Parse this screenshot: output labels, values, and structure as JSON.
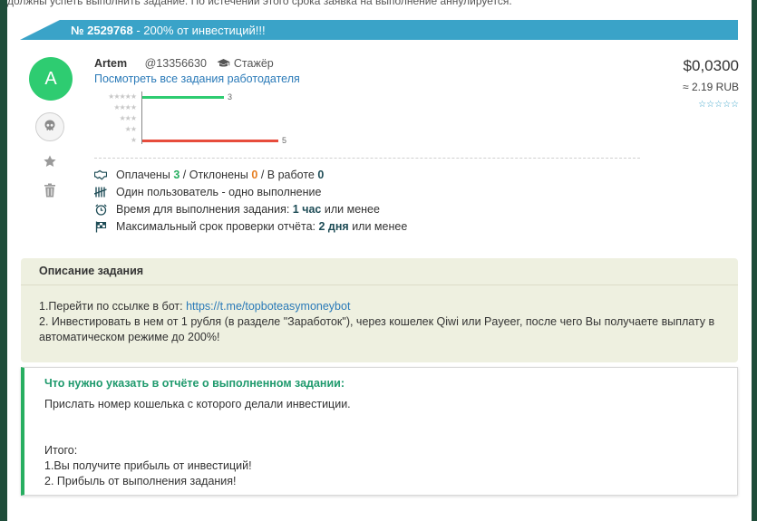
{
  "top_strip": "должны успеть выполнить задание. По истечении этого срока заявка на выполнение аннулируется.",
  "banner": {
    "number": "№ 2529768",
    "suffix": " - 200% от инвестиций!!!"
  },
  "employer": {
    "avatar_letter": "A",
    "name": "Artem",
    "id": "@13356630",
    "role": "Стажёр",
    "all_tasks_link": "Посмотреть все задания работодателя"
  },
  "rating": {
    "rows": [
      {
        "stars": "★★★★★",
        "count": "3",
        "value": 3
      },
      {
        "stars": "★★★★",
        "count": "",
        "value": 0
      },
      {
        "stars": "★★★",
        "count": "",
        "value": 0
      },
      {
        "stars": "★★",
        "count": "",
        "value": 0
      },
      {
        "stars": "★",
        "count": "5",
        "value": 5
      }
    ],
    "colors": {
      "positive": "#2ecc71",
      "negative": "#e74c3c"
    }
  },
  "price": {
    "usd": "$0,0300",
    "rub": "≈ 2.19 RUB",
    "stars": "☆☆☆☆☆"
  },
  "stats": {
    "paid_label": "Оплачены",
    "paid": "3",
    "sep1": "/",
    "rejected_label": "Отклонены",
    "rejected": "0",
    "sep2": "/",
    "in_work_label": "В работе",
    "in_work": "0",
    "one_user": "Один пользователь - одно выполнение",
    "time_label": "Время для выполнения задания:",
    "time_value": "1 час",
    "time_suffix": "или менее",
    "check_label": "Максимальный срок проверки отчёта:",
    "check_value": "2 дня",
    "check_suffix": "или менее"
  },
  "description": {
    "title": "Описание задания",
    "line1_prefix": "1.Перейти по ссылке в бот:",
    "line1_link": "https://t.me/topboteasymoneybot",
    "line2": "2. Инвестировать в нем от 1 рубля (в разделе \"Заработок\"), через кошелек Qiwi или Payeer, после чего Вы получаете выплату в автоматическом режиме до 200%!"
  },
  "report": {
    "title": "Что нужно указать в отчёте о выполненном задании:",
    "body": "Прислать номер кошелька с которого делали инвестиции.\n\n\nИтого:\n1.Вы получите прибыль от инвестиций!\n2. Прибыль от выполнения задания!"
  }
}
